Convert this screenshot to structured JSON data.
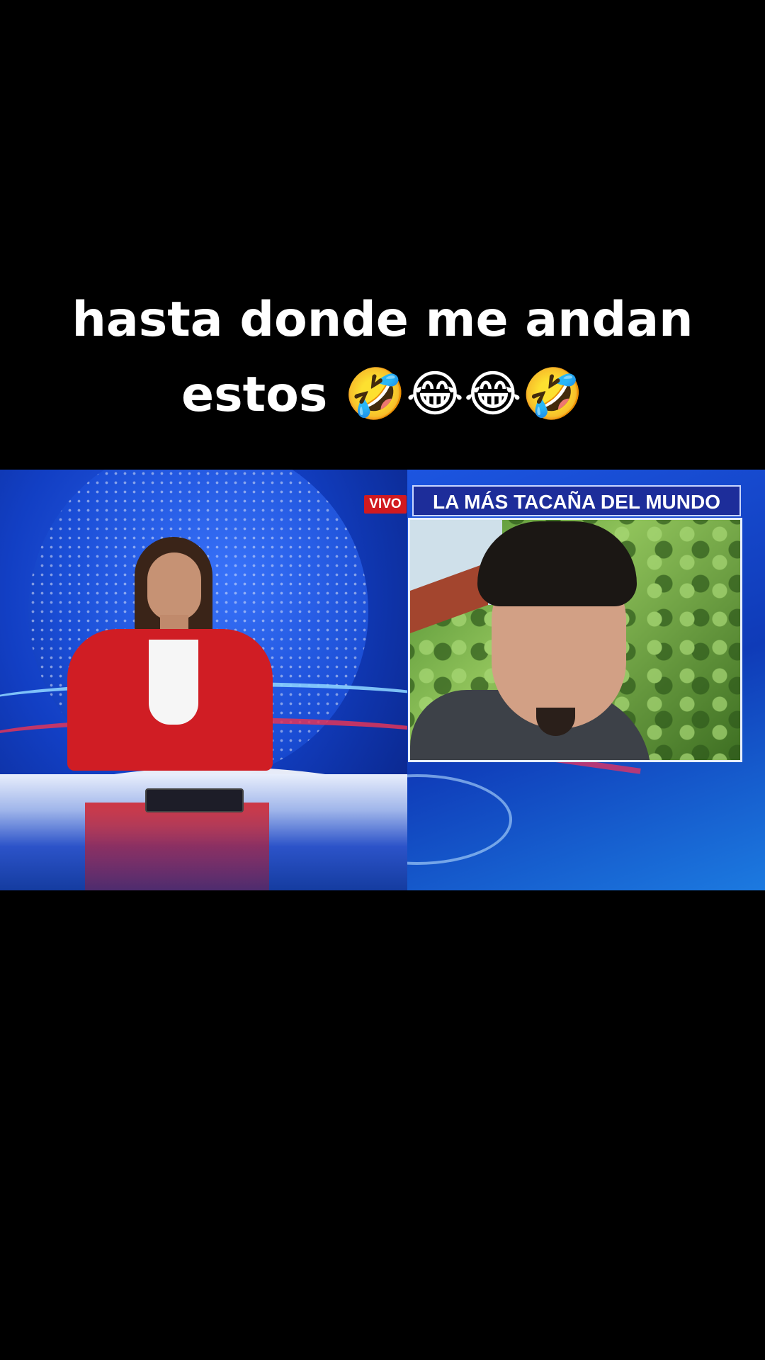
{
  "caption": {
    "line1": "hasta donde me andan",
    "line2_text": "estos",
    "line2_emojis": "🤣😂😂🤣"
  },
  "broadcast": {
    "live_label": "VIVO",
    "headline": "LA MÁS TACAÑA DEL MUNDO"
  },
  "colors": {
    "background": "#000000",
    "live_badge": "#d11a20",
    "headline_bar": "#1d2d9a",
    "studio_blue": "#123fc4"
  }
}
